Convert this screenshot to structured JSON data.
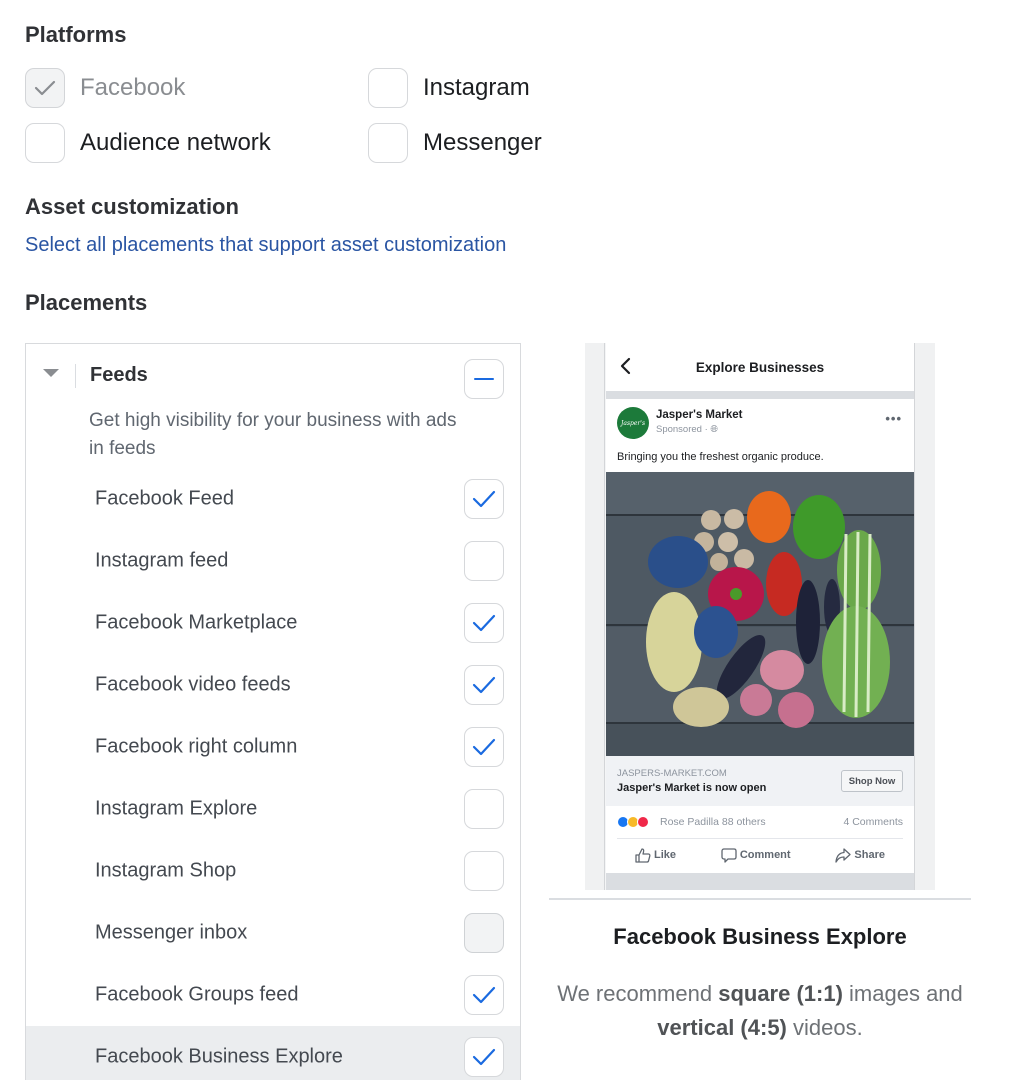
{
  "platforms": {
    "title": "Platforms",
    "items": [
      {
        "label": "Facebook",
        "checked": true,
        "disabled": true
      },
      {
        "label": "Instagram",
        "checked": false,
        "disabled": false
      },
      {
        "label": "Audience network",
        "checked": false,
        "disabled": false
      },
      {
        "label": "Messenger",
        "checked": false,
        "disabled": false
      }
    ]
  },
  "asset_customization": {
    "title": "Asset customization",
    "link": "Select all placements that support asset customization"
  },
  "placements": {
    "title": "Placements",
    "group": {
      "title": "Feeds",
      "state": "indeterminate",
      "description": "Get high visibility for your business with ads in feeds",
      "items": [
        {
          "label": "Facebook Feed",
          "checked": true,
          "disabled": false,
          "highlighted": false
        },
        {
          "label": "Instagram feed",
          "checked": false,
          "disabled": false,
          "highlighted": false
        },
        {
          "label": "Facebook Marketplace",
          "checked": true,
          "disabled": false,
          "highlighted": false
        },
        {
          "label": "Facebook video feeds",
          "checked": true,
          "disabled": false,
          "highlighted": false
        },
        {
          "label": "Facebook right column",
          "checked": true,
          "disabled": false,
          "highlighted": false
        },
        {
          "label": "Instagram Explore",
          "checked": false,
          "disabled": false,
          "highlighted": false
        },
        {
          "label": "Instagram Shop",
          "checked": false,
          "disabled": false,
          "highlighted": false
        },
        {
          "label": "Messenger inbox",
          "checked": false,
          "disabled": true,
          "highlighted": false
        },
        {
          "label": "Facebook Groups feed",
          "checked": true,
          "disabled": false,
          "highlighted": false
        },
        {
          "label": "Facebook Business Explore",
          "checked": true,
          "disabled": false,
          "highlighted": true
        }
      ]
    }
  },
  "preview": {
    "nav_title": "Explore Businesses",
    "post": {
      "page_name": "Jasper's Market",
      "avatar_text": "Jasper's",
      "sponsored": "Sponsored · ",
      "text": "Bringing you the freshest organic produce.",
      "image_icon": "vegetables-photo",
      "cta_url": "JASPERS-MARKET.COM",
      "cta_headline": "Jasper's Market is now open",
      "cta_button": "Shop Now",
      "reactions_text": "Rose Padilla 88 others",
      "comments": "4 Comments",
      "actions": [
        "Like",
        "Comment",
        "Share"
      ]
    },
    "title": "Facebook Business Explore",
    "desc_1": "We recommend ",
    "desc_bold_1": "square (1:1)",
    "desc_2": " images and ",
    "desc_bold_2": "vertical (4:5)",
    "desc_3": " videos."
  },
  "colors": {
    "accent_blue": "#1a6ae0",
    "link_blue": "#2a55a3",
    "avatar_green": "#1c7a3a"
  }
}
